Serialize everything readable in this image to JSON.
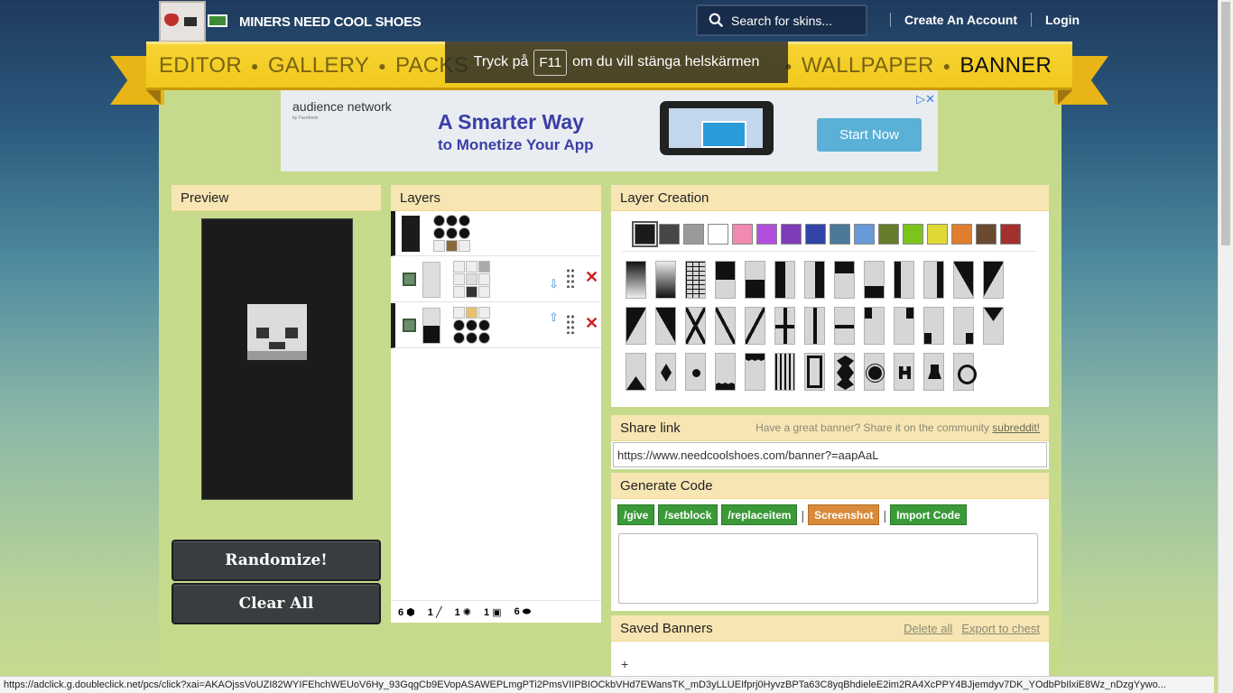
{
  "header": {
    "site_name": "MINERS NEED COOL SHOES",
    "search_placeholder": "Search for skins...",
    "create_account": "Create An Account",
    "login": "Login"
  },
  "nav": {
    "items": [
      "EDITOR",
      "GALLERY",
      "PACKS",
      "WALLPAPER",
      "BANNER"
    ],
    "active": "BANNER"
  },
  "fullscreen_notice": {
    "before": "Tryck på",
    "key": "F11",
    "after": "om du vill stänga helskärmen"
  },
  "ad": {
    "brand": "audience network",
    "brand_sub": "by Facebook",
    "headline": "A Smarter Way",
    "subheadline": "to Monetize Your App",
    "cta": "Start Now"
  },
  "preview": {
    "title": "Preview"
  },
  "buttons": {
    "randomize": "Randomize!",
    "clear_all": "Clear All"
  },
  "layers": {
    "title": "Layers",
    "counts": [
      "6",
      "1",
      "1",
      "1",
      "6"
    ]
  },
  "layer_creation": {
    "title": "Layer Creation",
    "colors": [
      "#1b1b1b",
      "#474747",
      "#9a9a9a",
      "#ffffff",
      "#f08ab0",
      "#b14fdc",
      "#7f3bb8",
      "#3244a8",
      "#4a7a98",
      "#6899d8",
      "#667d2c",
      "#7cc41c",
      "#e0d834",
      "#e07e2e",
      "#6a4a30",
      "#a3302c"
    ],
    "selected_color": "#1b1b1b"
  },
  "share": {
    "title": "Share link",
    "hint_text": "Have a great banner? Share it on the community",
    "hint_link": "subreddit!",
    "url": "https://www.needcoolshoes.com/banner?=aapAaL"
  },
  "generate": {
    "title": "Generate Code",
    "give": "/give",
    "setblock": "/setblock",
    "replaceitem": "/replaceitem",
    "screenshot": "Screenshot",
    "import": "Import Code"
  },
  "saved": {
    "title": "Saved Banners",
    "delete_all": "Delete all",
    "export": "Export to chest",
    "add": "+"
  },
  "status_url": "https://adclick.g.doubleclick.net/pcs/click?xai=AKAOjssVoUZI82WYIFEhchWEUoV6Hy_93GqgCb9EVopASAWEPLmgPTi2PmsVIIPBIOCkbVHd7EWansTK_mD3yLLUEIfprj0HyvzBPTa63C8yqBhdieleE2im2RA4XcPPY4BJjemdyv7DK_YOdbPbIlxiE8Wz_nDzgYywo..."
}
